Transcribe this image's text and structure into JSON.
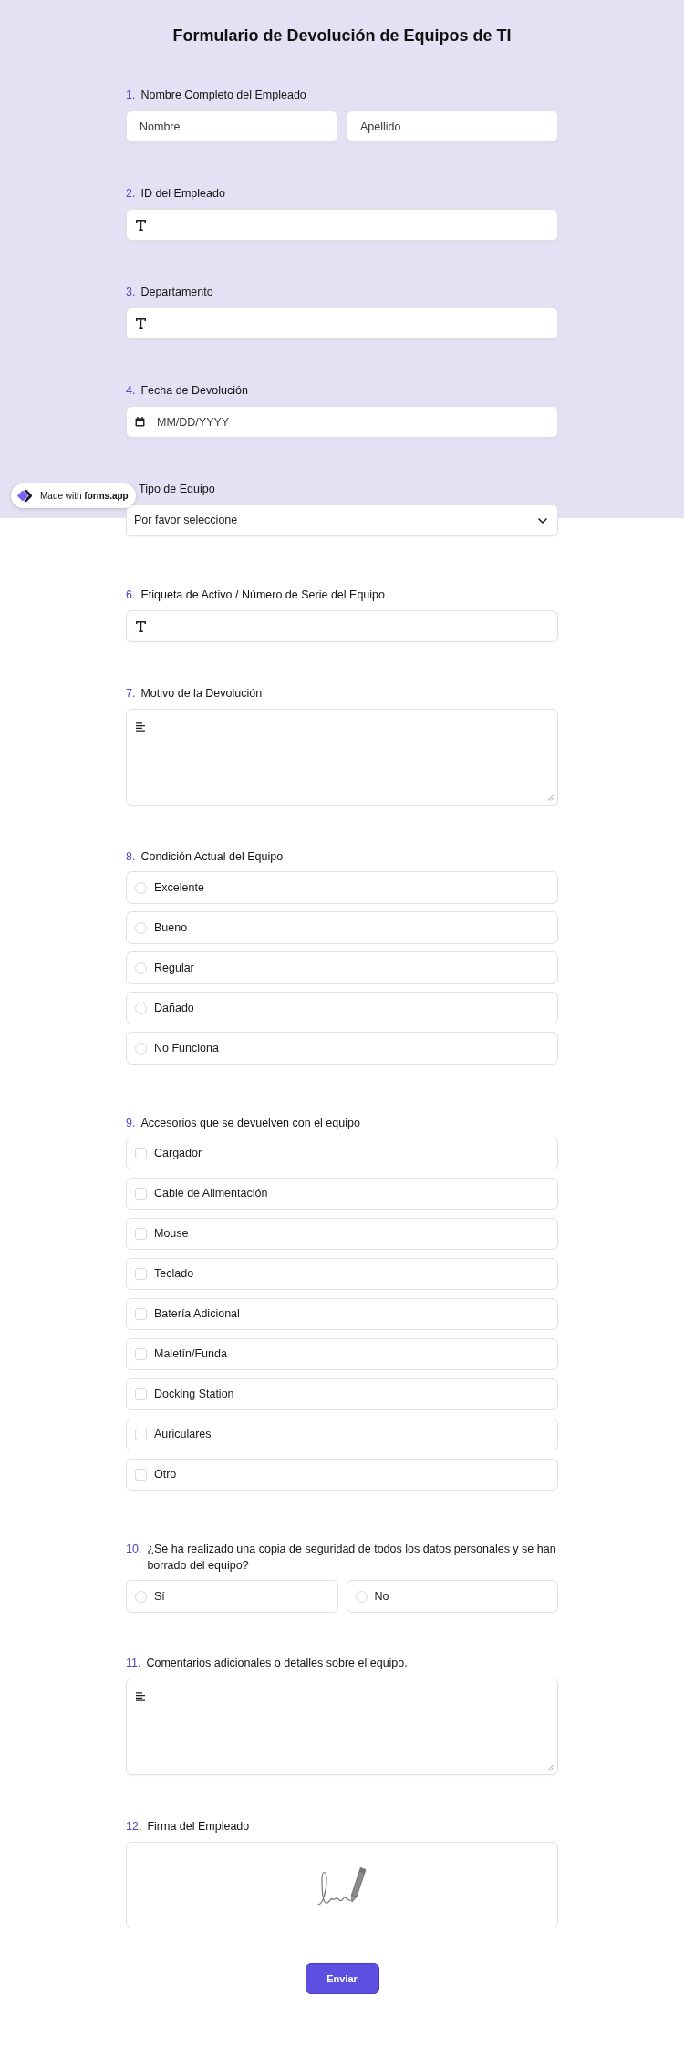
{
  "title": "Formulario de Devolución de Equipos de TI",
  "badge": {
    "text": "Made with **forms.app**"
  },
  "questions": [
    {
      "number": "1.",
      "label": "Nombre Completo del Empleado",
      "kind": "name",
      "fields": [
        {
          "placeholder": "Nombre"
        },
        {
          "placeholder": "Apellido"
        }
      ]
    },
    {
      "number": "2.",
      "label": "ID del Empleado",
      "kind": "text"
    },
    {
      "number": "3.",
      "label": "Departamento",
      "kind": "text"
    },
    {
      "number": "4.",
      "label": "Fecha de Devolución",
      "kind": "date",
      "placeholder": "MM/DD/YYYY"
    },
    {
      "label": "Tipo de Equipo",
      "kind": "select",
      "placeholder": "Por favor seleccione"
    },
    {
      "number": "6.",
      "label": "Etiqueta de Activo / Número de Serie del Equipo",
      "kind": "text"
    },
    {
      "number": "7.",
      "label": "Motivo de la Devolución",
      "kind": "textarea"
    },
    {
      "number": "8.",
      "label": "Condición Actual del Equipo",
      "kind": "radio",
      "options": [
        {
          "label": "Excelente",
          "selected": false
        },
        {
          "label": "Bueno",
          "selected": false
        },
        {
          "label": "Regular",
          "selected": false
        },
        {
          "label": "Dañado",
          "selected": false
        },
        {
          "label": "No Funciona",
          "selected": false
        }
      ]
    },
    {
      "number": "9.",
      "label": "Accesorios que se devuelven con el equipo",
      "kind": "checkbox",
      "options": [
        {
          "label": "Cargador",
          "checked": false
        },
        {
          "label": "Cable de Alimentación",
          "checked": false
        },
        {
          "label": "Mouse",
          "checked": false
        },
        {
          "label": "Teclado",
          "checked": false
        },
        {
          "label": "Batería Adicional",
          "checked": false
        },
        {
          "label": "Maletín/Funda",
          "checked": false
        },
        {
          "label": "Docking Station",
          "checked": false
        },
        {
          "label": "Auriculares",
          "checked": false
        },
        {
          "label": "Otro",
          "checked": false
        }
      ]
    },
    {
      "number": "10.",
      "label": "¿Se ha realizado una copia de seguridad de todos los datos personales y se han borrado del equipo?",
      "kind": "radio_grid",
      "options": [
        {
          "label": "Sí",
          "selected": false
        },
        {
          "label": "No",
          "selected": false
        }
      ]
    },
    {
      "number": "11.",
      "label": "Comentarios adicionales o detalles sobre el equipo.",
      "kind": "textarea"
    },
    {
      "number": "12.",
      "label": "Firma del Empleado",
      "kind": "signature"
    }
  ],
  "submit": {
    "label": "Enviar"
  }
}
